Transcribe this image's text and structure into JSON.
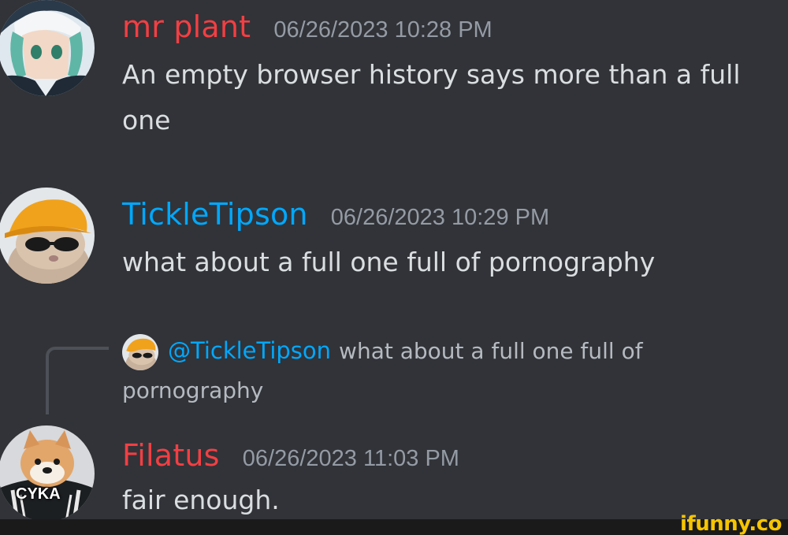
{
  "messages": [
    {
      "username": "mr plant",
      "username_color": "#f23f43",
      "timestamp": "06/26/2023 10:28 PM",
      "lines": [
        "An empty browser history says more than a full",
        "one"
      ]
    },
    {
      "username": "TickleTipson",
      "username_color": "#00a8fc",
      "timestamp": "06/26/2023 10:29 PM",
      "lines": [
        "what about a full one full of pornography"
      ]
    },
    {
      "reply": {
        "mention": "@TickleTipson",
        "text_line1": "what about a full one full of",
        "text_line2": "pornography"
      },
      "username": "Filatus",
      "username_color": "#f23f43",
      "timestamp": "06/26/2023 11:03 PM",
      "lines": [
        "fair enough."
      ],
      "avatar_caption": "CYKA"
    }
  ],
  "watermark": "ifunny.co",
  "colors": {
    "background": "#313338",
    "timestamp": "#949ba4",
    "text": "#dbdee1",
    "mention": "#00a8fc",
    "watermark": "#f6c400"
  }
}
